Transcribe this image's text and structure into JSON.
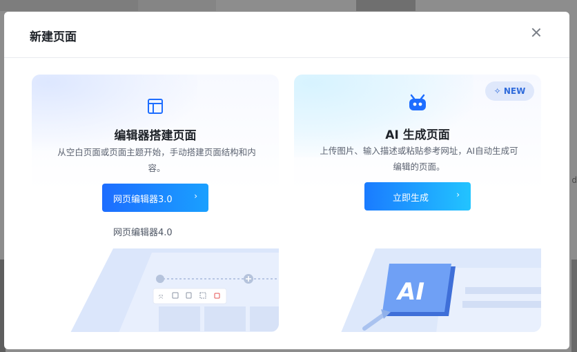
{
  "background": {
    "edge_text": "d"
  },
  "modal": {
    "title": "新建页面",
    "close_icon": "close-icon"
  },
  "editor_card": {
    "icon": "layout-icon",
    "title": "编辑器搭建页面",
    "description": "从空白页面或页面主题开始，手动搭建页面结构和内容。",
    "primary_button": "网页编辑器3.0",
    "primary_arrow": "›",
    "secondary_link": "网页编辑器4.0"
  },
  "ai_card": {
    "icon": "robot-icon",
    "badge": "✧ NEW",
    "title": "AI 生成页面",
    "description": "上传图片、输入描述或粘贴参考网址，AI自动生成可编辑的页面。",
    "primary_button": "立即生成",
    "primary_arrow": "›",
    "illustration_text": "AI"
  },
  "colors": {
    "accent": "#1d6dff",
    "accent_alt": "#22c4ff",
    "title": "#1f2329",
    "body_text": "#5b6270",
    "badge_bg": "#dfe8fb",
    "badge_text": "#2f6bdb"
  }
}
